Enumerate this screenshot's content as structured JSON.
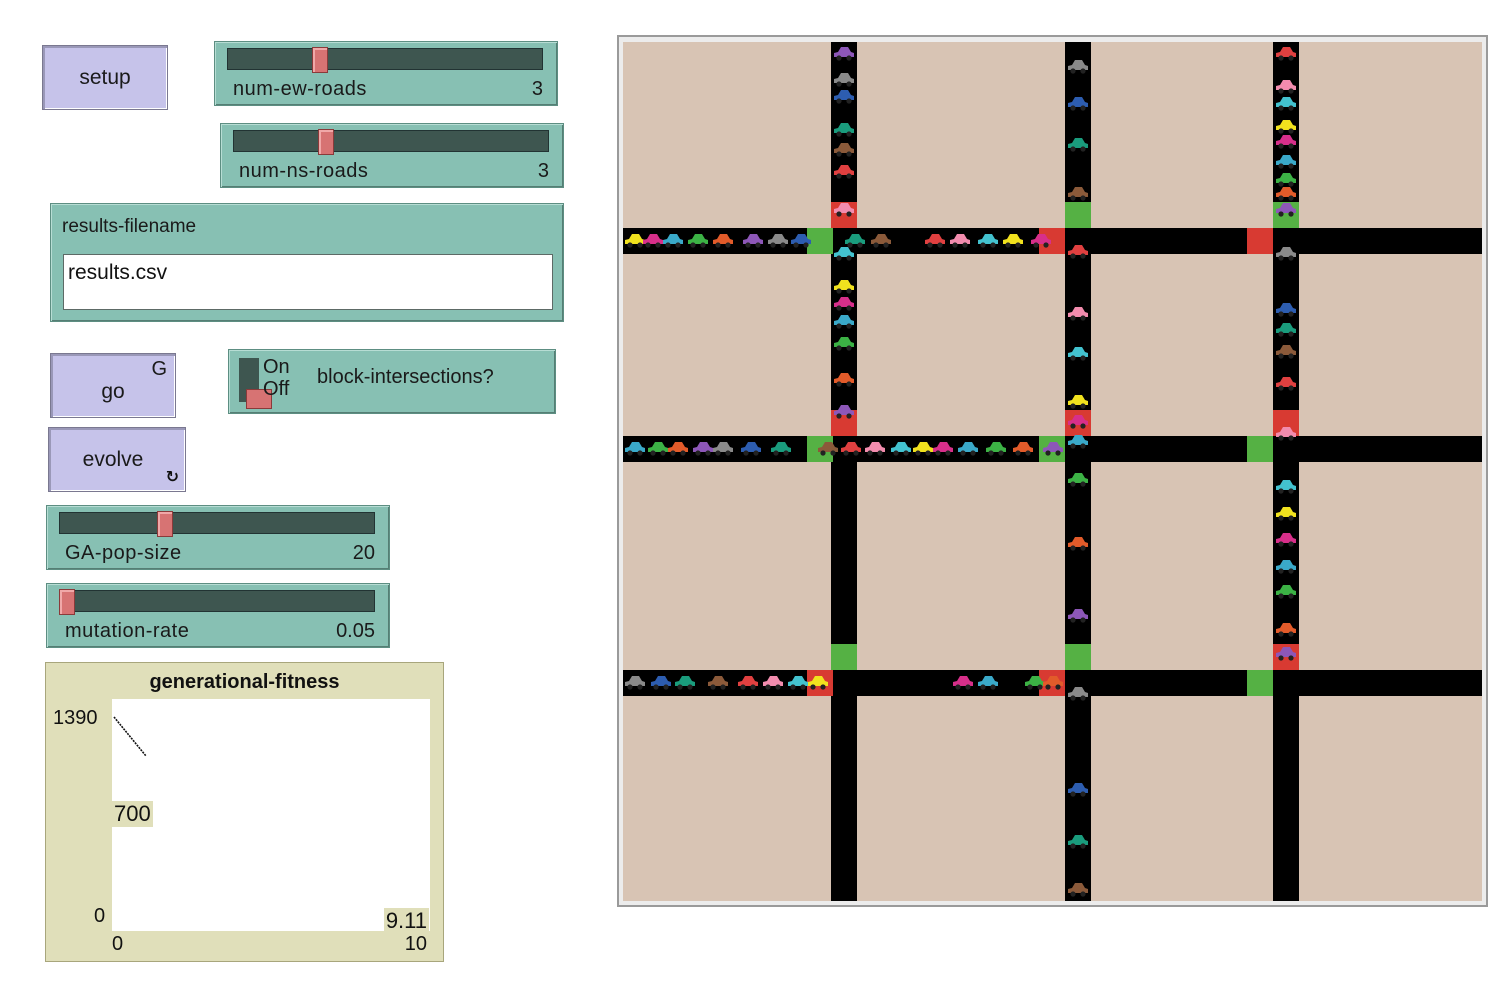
{
  "buttons": {
    "setup": {
      "label": "setup"
    },
    "go": {
      "label": "go",
      "key": "G"
    },
    "evolve": {
      "label": "evolve",
      "forever_icon": "↻"
    }
  },
  "sliders": {
    "num_ew_roads": {
      "name": "num-ew-roads",
      "value": "3",
      "fraction": 0.29
    },
    "num_ns_roads": {
      "name": "num-ns-roads",
      "value": "3",
      "fraction": 0.29
    },
    "ga_pop_size": {
      "name": "GA-pop-size",
      "value": "20",
      "fraction": 0.33
    },
    "mutation_rate": {
      "name": "mutation-rate",
      "value": "0.05",
      "fraction": 0.02
    }
  },
  "inputs": {
    "results_filename": {
      "title": "results-filename",
      "value": "results.csv"
    }
  },
  "switches": {
    "block_intersections": {
      "name": "block-intersections?",
      "on_label": "On",
      "off_label": "Off",
      "state": "off"
    }
  },
  "plot": {
    "title": "generational-fitness",
    "y_max": "1390",
    "y_mid": "700",
    "y_min": "0",
    "x_min": "0",
    "x_max": "10",
    "x_current": "9.11"
  },
  "world": {
    "background": "#d8c4b4",
    "road_color": "#000000",
    "green_light": "#55b144",
    "red_light": "#d83a32",
    "ew_roads": 3,
    "ns_roads": 3,
    "car_colors": [
      "#f1e21e",
      "#d72f8a",
      "#3aa9c9",
      "#3cb245",
      "#e25b2a",
      "#8d57b8",
      "#8a8a8a",
      "#2d5db0",
      "#1a9c7d",
      "#8b5a3a",
      "#e04040",
      "#f28cae",
      "#43c2cf"
    ]
  }
}
